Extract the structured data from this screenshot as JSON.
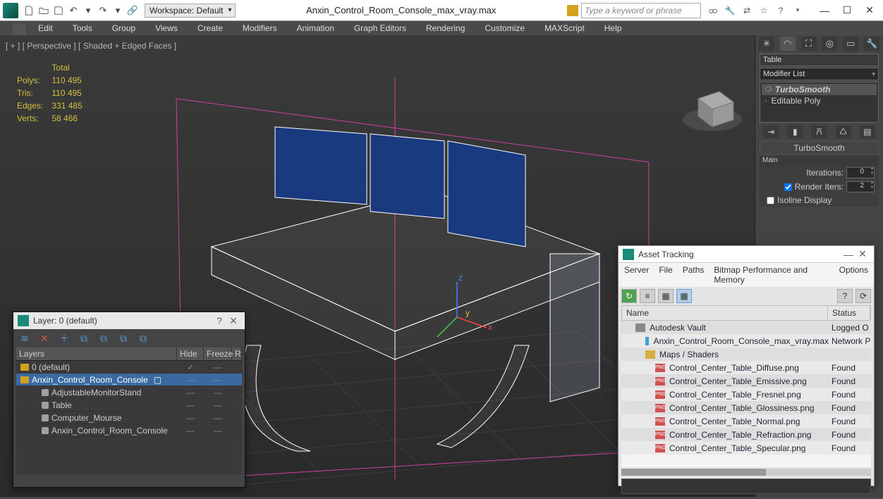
{
  "title": "Anxin_Control_Room_Console_max_vray.max",
  "workspace_label": "Workspace: Default",
  "search_placeholder": "Type a keyword or phrase",
  "menubar": [
    "Edit",
    "Tools",
    "Group",
    "Views",
    "Create",
    "Modifiers",
    "Animation",
    "Graph Editors",
    "Rendering",
    "Customize",
    "MAXScript",
    "Help"
  ],
  "viewport": {
    "label": "[ + ] [ Perspective ] [ Shaded + Edged Faces ]",
    "stats_head": "Total",
    "stats": {
      "polys_label": "Polys:",
      "polys": "110 495",
      "tris_label": "Tris:",
      "tris": "110 495",
      "edges_label": "Edges:",
      "edges": "331 485",
      "verts_label": "Verts:",
      "verts": "58 466"
    }
  },
  "rightpanel": {
    "object_name": "Table",
    "modifier_list_label": "Modifier List",
    "mod1": "TurboSmooth",
    "mod2": "Editable Poly",
    "rollout_title": "TurboSmooth",
    "rollout_sub": "Main",
    "iter_label": "Iterations:",
    "iter_val": "0",
    "rend_label": "Render Iters:",
    "rend_val": "2",
    "isoline_label": "Isoline Display"
  },
  "layer_dlg": {
    "title": "Layer: 0 (default)",
    "cols": {
      "name": "Layers",
      "hide": "Hide",
      "freeze": "Freeze",
      "r": "R"
    },
    "rows": [
      {
        "text": "0 (default)",
        "icon": "yellow",
        "indent": 0,
        "sel": false,
        "check": true
      },
      {
        "text": "Anxin_Control_Room_Console",
        "icon": "yellow",
        "indent": 0,
        "sel": true,
        "check": false
      },
      {
        "text": "AdjustableMonitorStand",
        "icon": "obj",
        "indent": 2,
        "sel": false
      },
      {
        "text": "Table",
        "icon": "obj",
        "indent": 2,
        "sel": false
      },
      {
        "text": "Computer_Mourse",
        "icon": "obj",
        "indent": 2,
        "sel": false
      },
      {
        "text": "Anxin_Control_Room_Console",
        "icon": "obj",
        "indent": 2,
        "sel": false
      }
    ]
  },
  "asset_dlg": {
    "title": "Asset Tracking",
    "menu": [
      "Server",
      "File",
      "Paths",
      "Bitmap Performance and Memory",
      "Options"
    ],
    "cols": {
      "name": "Name",
      "status": "Status"
    },
    "rows": [
      {
        "text": "Autodesk Vault",
        "icon": "vault",
        "ind": 1,
        "status": "Logged O"
      },
      {
        "text": "Anxin_Control_Room_Console_max_vray.max",
        "icon": "max",
        "ind": 2,
        "status": "Network P"
      },
      {
        "text": "Maps / Shaders",
        "icon": "fold",
        "ind": 2,
        "status": ""
      },
      {
        "text": "Control_Center_Table_Diffuse.png",
        "icon": "png",
        "ind": 3,
        "status": "Found"
      },
      {
        "text": "Control_Center_Table_Emissive.png",
        "icon": "png",
        "ind": 3,
        "status": "Found"
      },
      {
        "text": "Control_Center_Table_Fresnel.png",
        "icon": "png",
        "ind": 3,
        "status": "Found"
      },
      {
        "text": "Control_Center_Table_Glossiness.png",
        "icon": "png",
        "ind": 3,
        "status": "Found"
      },
      {
        "text": "Control_Center_Table_Normal.png",
        "icon": "png",
        "ind": 3,
        "status": "Found"
      },
      {
        "text": "Control_Center_Table_Refraction.png",
        "icon": "png",
        "ind": 3,
        "status": "Found"
      },
      {
        "text": "Control_Center_Table_Specular.png",
        "icon": "png",
        "ind": 3,
        "status": "Found"
      }
    ]
  }
}
